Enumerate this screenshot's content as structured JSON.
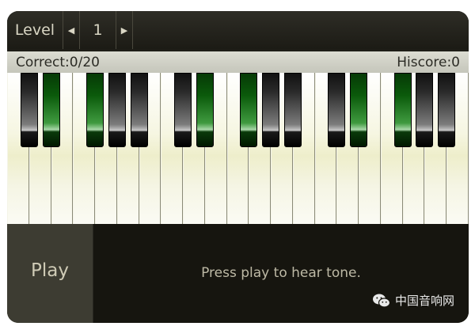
{
  "topbar": {
    "level_label": "Level",
    "level_decrease_glyph": "◀",
    "level_value": "1",
    "level_increase_glyph": "▶"
  },
  "scorebar": {
    "correct": "Correct:0/20",
    "hiscore": "Hiscore:0"
  },
  "keyboard": {
    "white_key_count": 21,
    "black_keys": [
      {
        "name": "black-key-1",
        "highlighted": false
      },
      {
        "name": "black-key-2",
        "highlighted": true
      },
      {
        "name": "black-key-3",
        "highlighted": true
      },
      {
        "name": "black-key-4",
        "highlighted": false
      },
      {
        "name": "black-key-5",
        "highlighted": false
      },
      {
        "name": "black-key-6",
        "highlighted": false
      },
      {
        "name": "black-key-7",
        "highlighted": true
      },
      {
        "name": "black-key-8",
        "highlighted": true
      },
      {
        "name": "black-key-9",
        "highlighted": false
      },
      {
        "name": "black-key-10",
        "highlighted": false
      },
      {
        "name": "black-key-11",
        "highlighted": false
      },
      {
        "name": "black-key-12",
        "highlighted": true
      },
      {
        "name": "black-key-13",
        "highlighted": true
      },
      {
        "name": "black-key-14",
        "highlighted": false
      },
      {
        "name": "black-key-15",
        "highlighted": false
      }
    ],
    "highlight_color": "#0b5a0b"
  },
  "play_label": "Play",
  "status": "Press play to hear tone.",
  "watermark": {
    "text": "中国音响网",
    "icon": "wechat-icon"
  }
}
